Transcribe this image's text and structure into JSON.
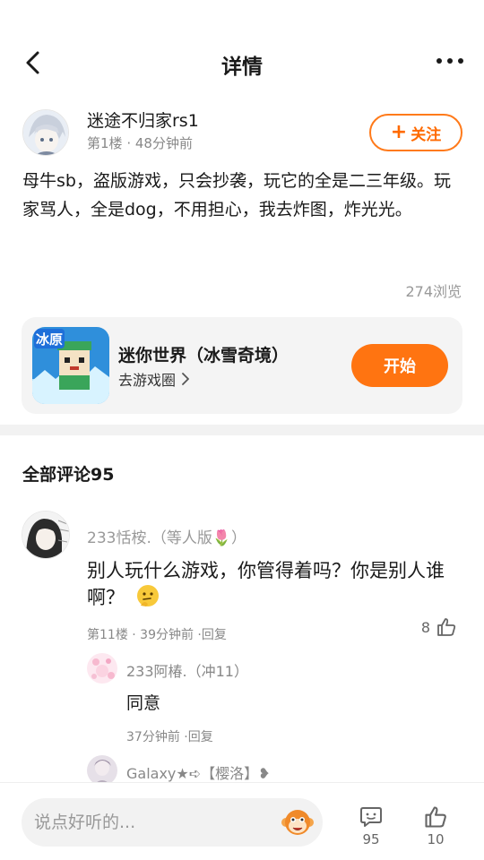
{
  "header": {
    "title": "详情",
    "back_icon": "chevron-left-icon",
    "more_icon": "more-dots-icon"
  },
  "post": {
    "author_name": "迷途不归家rs1",
    "floor": "第1楼",
    "dot": "·",
    "time": "48分钟前",
    "follow_plus": "+",
    "follow_label": "关注",
    "body": "母牛sb，盗版游戏，只会抄袭，玩它的全是二三年级。玩家骂人，全是dog，不用担心，我去炸图，炸光光。",
    "views": "274浏览"
  },
  "game_card": {
    "icon_text": "冰原",
    "title": "迷你世界（冰雪奇境）",
    "link_label": "去游戏圈",
    "start_label": "开始"
  },
  "comments": {
    "header": "全部评论95",
    "items": [
      {
        "name": "233恬桉.（等人版🌷）",
        "text": "别人玩什么游戏，你管得着吗？你是别人谁啊？",
        "emoji": "thinking-emoji",
        "meta": "第11楼 · 39分钟前 ·回复",
        "likes": "8",
        "replies": [
          {
            "name": "233阿椿.（冲11）",
            "text": "同意",
            "meta": "37分钟前 ·回复"
          },
          {
            "name": "Galaxy★➪【樱洛】❥"
          }
        ]
      }
    ]
  },
  "bottom_bar": {
    "input_placeholder": "说点好听的...",
    "comment_count": "95",
    "like_count": "10"
  },
  "colors": {
    "accent": "#ff7411",
    "card_bg": "#f4f4f4",
    "muted_text": "#888888"
  }
}
